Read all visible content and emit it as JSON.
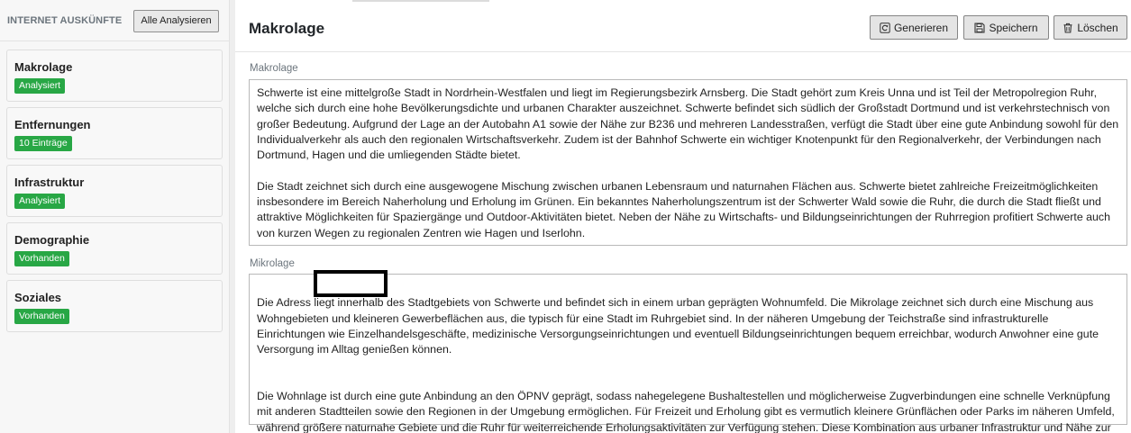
{
  "sidebar": {
    "title": "INTERNET AUSKÜNFTE",
    "analyze_all_label": "Alle Analysieren",
    "items": [
      {
        "label": "Makrolage",
        "badge": "Analysiert"
      },
      {
        "label": "Entfernungen",
        "badge": "10 Einträge"
      },
      {
        "label": "Infrastruktur",
        "badge": "Analysiert"
      },
      {
        "label": "Demographie",
        "badge": "Vorhanden"
      },
      {
        "label": "Soziales",
        "badge": "Vorhanden"
      }
    ],
    "badge_color": "#28a745"
  },
  "main": {
    "title": "Makrolage",
    "toolbar": {
      "generate_label": "Generieren",
      "generate_icon": "refresh-icon",
      "save_label": "Speichern",
      "save_icon": "floppy-disk-icon",
      "delete_label": "Löschen",
      "delete_icon": "trash-icon"
    },
    "makrolage": {
      "label": "Makrolage",
      "paragraphs": [
        "Schwerte ist eine mittelgroße Stadt in Nordrhein-Westfalen und liegt im Regierungsbezirk Arnsberg. Die Stadt gehört zum Kreis Unna und ist Teil der Metropolregion Ruhr, welche sich durch eine hohe Bevölkerungsdichte und urbanen Charakter auszeichnet. Schwerte befindet sich südlich der Großstadt Dortmund und ist verkehrstechnisch von großer Bedeutung. Aufgrund der Lage an der Autobahn A1 sowie der Nähe zur B236 und mehreren Landesstraßen, verfügt die Stadt über eine gute Anbindung sowohl für den Individualverkehr als auch den regionalen Wirtschaftsverkehr. Zudem ist der Bahnhof Schwerte ein wichtiger Knotenpunkt für den Regionalverkehr, der Verbindungen nach Dortmund, Hagen und die umliegenden Städte bietet.",
        "Die Stadt zeichnet sich durch eine ausgewogene Mischung zwischen urbanen Lebensraum und naturnahen Flächen aus. Schwerte bietet zahlreiche Freizeitmöglichkeiten insbesondere im Bereich Naherholung und Erholung im Grünen. Ein bekanntes Naherholungszentrum ist der Schwerter Wald sowie die Ruhr, die durch die Stadt fließt und attraktive Möglichkeiten für Spaziergänge und Outdoor-Aktivitäten bietet. Neben der Nähe zu Wirtschafts- und Bildungseinrichtungen der Ruhrregion profitiert Schwerte auch von kurzen Wegen zu regionalen Zentren wie Hagen und Iserlohn."
      ]
    },
    "mikrolage": {
      "label": "Mikrolage",
      "paragraphs": [
        "Die Adress                    liegt innerhalb des Stadtgebiets von Schwerte und befindet sich in einem urban geprägten Wohnumfeld. Die Mikrolage zeichnet sich durch eine Mischung aus Wohngebieten und kleineren Gewerbeflächen aus, die typisch für eine Stadt im Ruhrgebiet sind. In der näheren Umgebung der Teichstraße sind infrastrukturelle Einrichtungen wie Einzelhandelsgeschäfte, medizinische Versorgungseinrichtungen und eventuell Bildungseinrichtungen bequem erreichbar, wodurch Anwohner eine gute Versorgung im Alltag genießen können.",
        "Die Wohnlage ist durch eine gute Anbindung an den ÖPNV geprägt, sodass nahegelegene Bushaltestellen und möglicherweise Zugverbindungen eine schnelle Verknüpfung mit anderen Stadtteilen sowie den Regionen in der Umgebung ermöglichen. Für Freizeit und Erholung gibt es vermutlich kleinere Grünflächen oder Parks im näheren Umfeld, während größere naturnahe Gebiete und die Ruhr für weiterreichende Erholungsaktivitäten zur Verfügung stehen. Diese Kombination aus urbaner Infrastruktur und Nähe zur Natur hebt die Mikrolage hervor."
      ]
    }
  }
}
